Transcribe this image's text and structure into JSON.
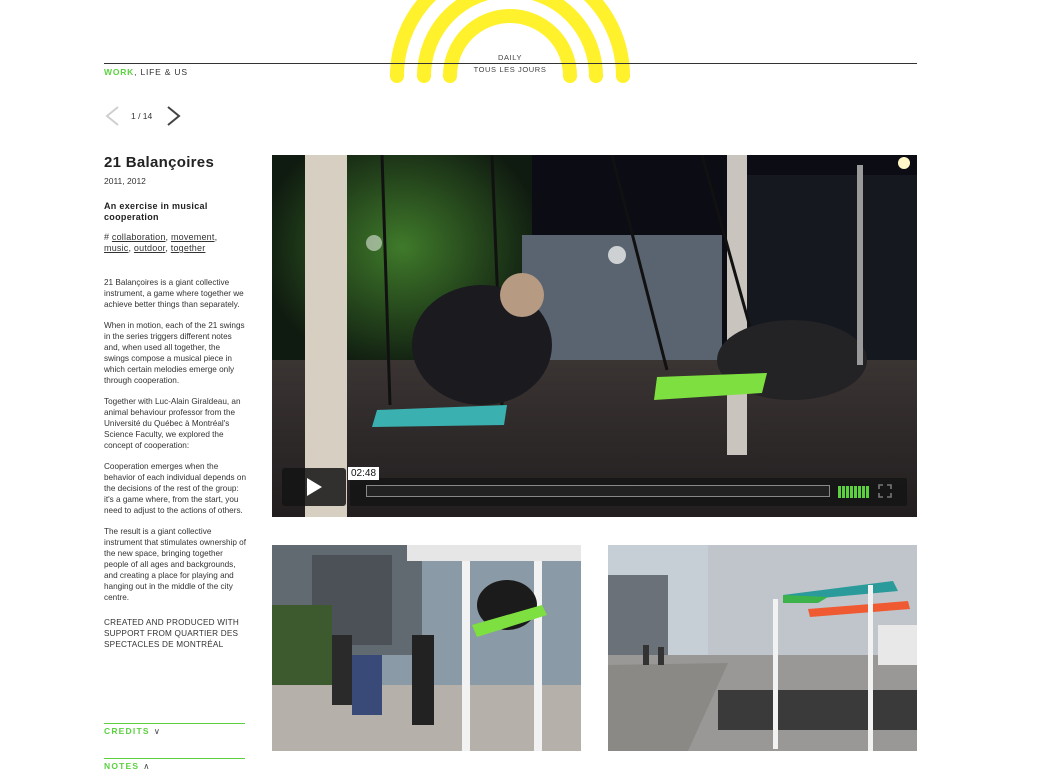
{
  "brand": {
    "name_line1": "DAILY",
    "name_line2": "TOUS LES JOURS",
    "accent": "#5bd140",
    "logo_color": "#fff12b"
  },
  "nav": {
    "work": "WORK",
    "rest": ", LIFE & US"
  },
  "pager": {
    "count": "1 / 14",
    "prev_icon": "chevron-left-icon",
    "next_icon": "chevron-right-icon"
  },
  "project": {
    "title": "21 Balançoires",
    "years": "2011, 2012",
    "subtitle": "An exercise in musical cooperation",
    "tags_prefix": "# ",
    "tags": [
      "collaboration",
      "movement",
      "music",
      "outdoor",
      "together"
    ],
    "paragraphs": [
      "21 Balançoires is a giant collective instrument, a game where together we achieve better things than separately.",
      "When in motion, each of the 21 swings in the series triggers different notes and, when used all together, the swings compose a musical piece in which certain melodies emerge only through cooperation.",
      "Together with Luc-Alain Giraldeau, an animal behaviour professor from the Université du Québec à Montréal's Science Faculty, we explored the concept of cooperation:",
      "Cooperation emerges when the behavior of each individual depends on the decisions of the rest of the group: it's a game where, from the start, you need to adjust to the actions of others.",
      "The result is a giant collective instrument that stimulates ownership of the new space, bringing together people of all ages and backgrounds, and creating a place for playing and hanging out in the middle of the city centre."
    ],
    "credit_line": "Created and produced with support from Quartier des Spectacles de Montréal"
  },
  "sections": {
    "credits": "CREDITS",
    "notes": "NOTES"
  },
  "video": {
    "time": "02:48",
    "play_icon": "play-icon",
    "volume_icon": "volume-bars-icon",
    "fullscreen_icon": "fullscreen-icon"
  }
}
